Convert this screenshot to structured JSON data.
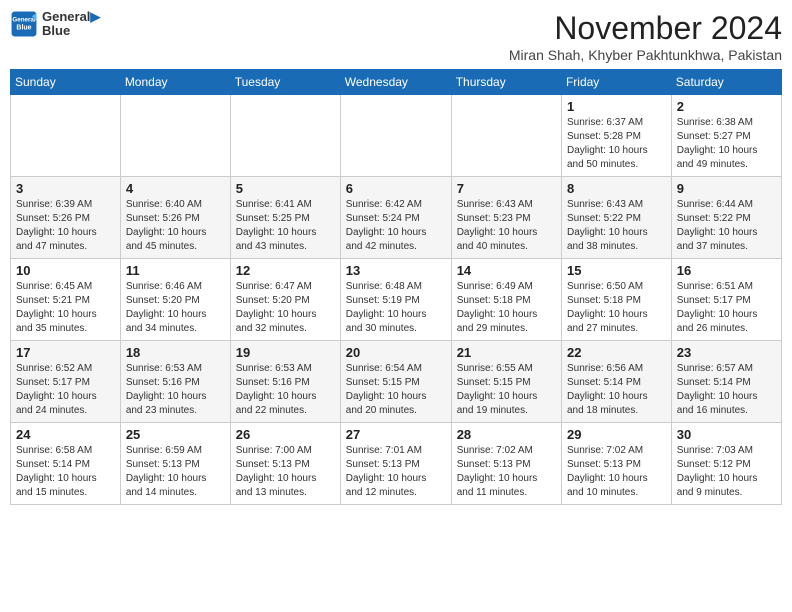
{
  "header": {
    "logo_line1": "General",
    "logo_line2": "Blue",
    "month": "November 2024",
    "location": "Miran Shah, Khyber Pakhtunkhwa, Pakistan"
  },
  "weekdays": [
    "Sunday",
    "Monday",
    "Tuesday",
    "Wednesday",
    "Thursday",
    "Friday",
    "Saturday"
  ],
  "weeks": [
    [
      {
        "day": "",
        "info": ""
      },
      {
        "day": "",
        "info": ""
      },
      {
        "day": "",
        "info": ""
      },
      {
        "day": "",
        "info": ""
      },
      {
        "day": "",
        "info": ""
      },
      {
        "day": "1",
        "info": "Sunrise: 6:37 AM\nSunset: 5:28 PM\nDaylight: 10 hours and 50 minutes."
      },
      {
        "day": "2",
        "info": "Sunrise: 6:38 AM\nSunset: 5:27 PM\nDaylight: 10 hours and 49 minutes."
      }
    ],
    [
      {
        "day": "3",
        "info": "Sunrise: 6:39 AM\nSunset: 5:26 PM\nDaylight: 10 hours and 47 minutes."
      },
      {
        "day": "4",
        "info": "Sunrise: 6:40 AM\nSunset: 5:26 PM\nDaylight: 10 hours and 45 minutes."
      },
      {
        "day": "5",
        "info": "Sunrise: 6:41 AM\nSunset: 5:25 PM\nDaylight: 10 hours and 43 minutes."
      },
      {
        "day": "6",
        "info": "Sunrise: 6:42 AM\nSunset: 5:24 PM\nDaylight: 10 hours and 42 minutes."
      },
      {
        "day": "7",
        "info": "Sunrise: 6:43 AM\nSunset: 5:23 PM\nDaylight: 10 hours and 40 minutes."
      },
      {
        "day": "8",
        "info": "Sunrise: 6:43 AM\nSunset: 5:22 PM\nDaylight: 10 hours and 38 minutes."
      },
      {
        "day": "9",
        "info": "Sunrise: 6:44 AM\nSunset: 5:22 PM\nDaylight: 10 hours and 37 minutes."
      }
    ],
    [
      {
        "day": "10",
        "info": "Sunrise: 6:45 AM\nSunset: 5:21 PM\nDaylight: 10 hours and 35 minutes."
      },
      {
        "day": "11",
        "info": "Sunrise: 6:46 AM\nSunset: 5:20 PM\nDaylight: 10 hours and 34 minutes."
      },
      {
        "day": "12",
        "info": "Sunrise: 6:47 AM\nSunset: 5:20 PM\nDaylight: 10 hours and 32 minutes."
      },
      {
        "day": "13",
        "info": "Sunrise: 6:48 AM\nSunset: 5:19 PM\nDaylight: 10 hours and 30 minutes."
      },
      {
        "day": "14",
        "info": "Sunrise: 6:49 AM\nSunset: 5:18 PM\nDaylight: 10 hours and 29 minutes."
      },
      {
        "day": "15",
        "info": "Sunrise: 6:50 AM\nSunset: 5:18 PM\nDaylight: 10 hours and 27 minutes."
      },
      {
        "day": "16",
        "info": "Sunrise: 6:51 AM\nSunset: 5:17 PM\nDaylight: 10 hours and 26 minutes."
      }
    ],
    [
      {
        "day": "17",
        "info": "Sunrise: 6:52 AM\nSunset: 5:17 PM\nDaylight: 10 hours and 24 minutes."
      },
      {
        "day": "18",
        "info": "Sunrise: 6:53 AM\nSunset: 5:16 PM\nDaylight: 10 hours and 23 minutes."
      },
      {
        "day": "19",
        "info": "Sunrise: 6:53 AM\nSunset: 5:16 PM\nDaylight: 10 hours and 22 minutes."
      },
      {
        "day": "20",
        "info": "Sunrise: 6:54 AM\nSunset: 5:15 PM\nDaylight: 10 hours and 20 minutes."
      },
      {
        "day": "21",
        "info": "Sunrise: 6:55 AM\nSunset: 5:15 PM\nDaylight: 10 hours and 19 minutes."
      },
      {
        "day": "22",
        "info": "Sunrise: 6:56 AM\nSunset: 5:14 PM\nDaylight: 10 hours and 18 minutes."
      },
      {
        "day": "23",
        "info": "Sunrise: 6:57 AM\nSunset: 5:14 PM\nDaylight: 10 hours and 16 minutes."
      }
    ],
    [
      {
        "day": "24",
        "info": "Sunrise: 6:58 AM\nSunset: 5:14 PM\nDaylight: 10 hours and 15 minutes."
      },
      {
        "day": "25",
        "info": "Sunrise: 6:59 AM\nSunset: 5:13 PM\nDaylight: 10 hours and 14 minutes."
      },
      {
        "day": "26",
        "info": "Sunrise: 7:00 AM\nSunset: 5:13 PM\nDaylight: 10 hours and 13 minutes."
      },
      {
        "day": "27",
        "info": "Sunrise: 7:01 AM\nSunset: 5:13 PM\nDaylight: 10 hours and 12 minutes."
      },
      {
        "day": "28",
        "info": "Sunrise: 7:02 AM\nSunset: 5:13 PM\nDaylight: 10 hours and 11 minutes."
      },
      {
        "day": "29",
        "info": "Sunrise: 7:02 AM\nSunset: 5:13 PM\nDaylight: 10 hours and 10 minutes."
      },
      {
        "day": "30",
        "info": "Sunrise: 7:03 AM\nSunset: 5:12 PM\nDaylight: 10 hours and 9 minutes."
      }
    ]
  ]
}
